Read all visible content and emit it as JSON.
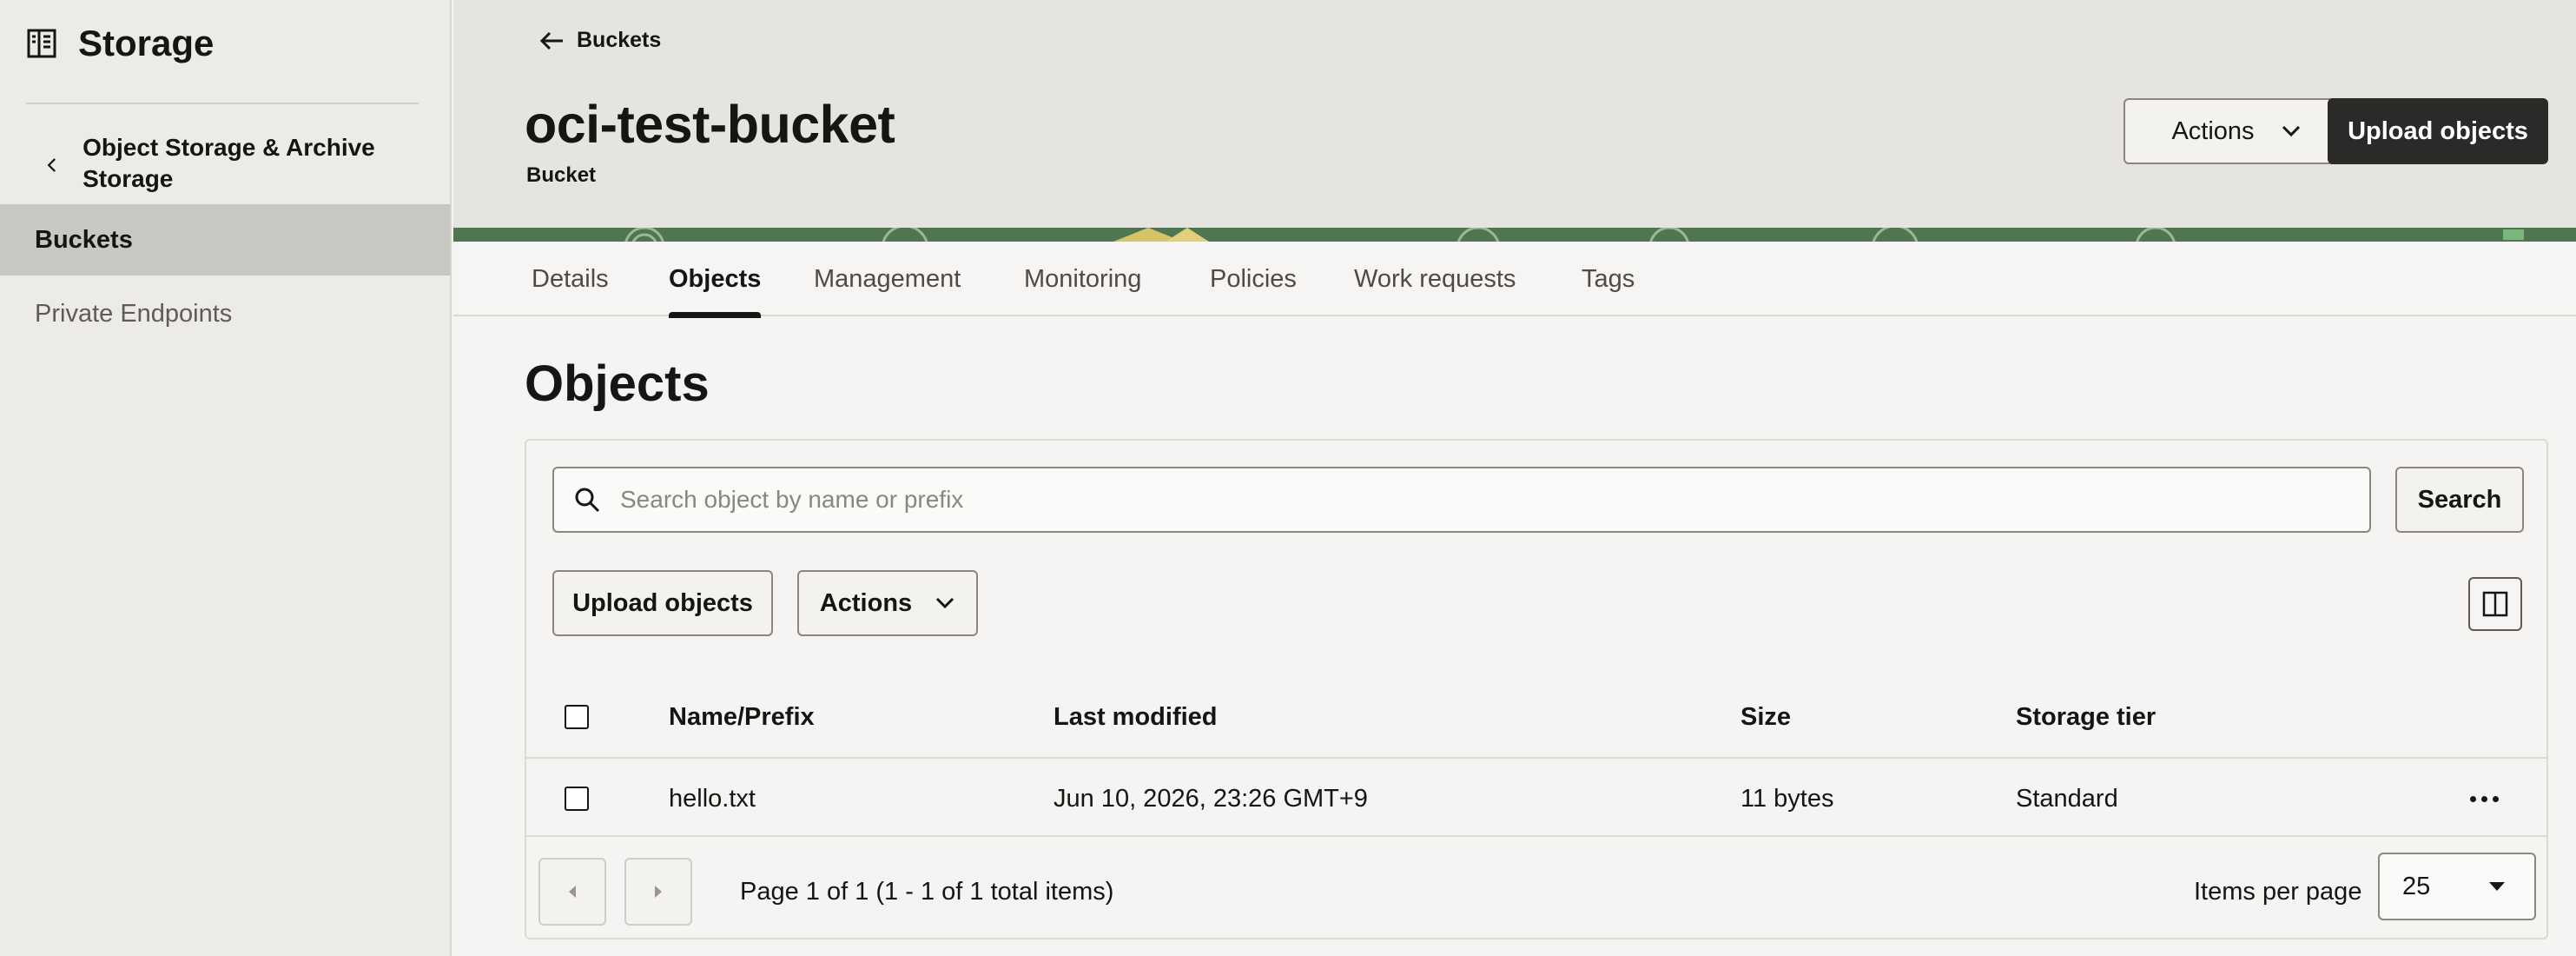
{
  "sidebar": {
    "title": "Storage",
    "back_label": "Object Storage & Archive Storage",
    "items": [
      {
        "label": "Buckets",
        "active": true
      },
      {
        "label": "Private Endpoints",
        "active": false
      }
    ]
  },
  "header": {
    "back_label": "Buckets",
    "title": "oci-test-bucket",
    "subtitle": "Bucket",
    "actions_label": "Actions",
    "upload_label": "Upload objects"
  },
  "tabs": [
    {
      "label": "Details",
      "active": false
    },
    {
      "label": "Objects",
      "active": true
    },
    {
      "label": "Management",
      "active": false
    },
    {
      "label": "Monitoring",
      "active": false
    },
    {
      "label": "Policies",
      "active": false
    },
    {
      "label": "Work requests",
      "active": false
    },
    {
      "label": "Tags",
      "active": false
    }
  ],
  "objects": {
    "title": "Objects",
    "search_placeholder": "Search object by name or prefix",
    "search_button": "Search",
    "upload_button": "Upload objects",
    "actions_button": "Actions",
    "columns": [
      "Name/Prefix",
      "Last modified",
      "Size",
      "Storage tier"
    ],
    "rows": [
      {
        "name": "hello.txt",
        "modified": "Jun 10, 2026, 23:26 GMT+9",
        "size": "11 bytes",
        "tier": "Standard"
      }
    ],
    "pagination_text": "Page 1 of 1 (1 - 1 of 1 total items)",
    "items_per_page_label": "Items per page",
    "items_per_page_value": "25"
  },
  "icons": {
    "storage": "storage-icon",
    "back": "arrow-left-icon",
    "chevron": "chevron-down-icon",
    "search": "search-icon",
    "columns": "column-toggle-icon",
    "more": "more-horizontal-icon"
  },
  "colors": {
    "primary_button": "#2b2a28",
    "banner": "#4f7650",
    "sidebar_active": "#c9c7c2"
  }
}
